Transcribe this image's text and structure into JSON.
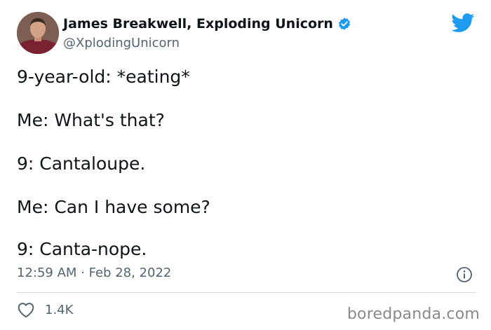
{
  "author": {
    "display_name": "James Breakwell, Exploding Unicorn",
    "handle": "@XplodingUnicorn",
    "avatar_icon": "avatar-photo",
    "verified_icon": "verified-badge-icon"
  },
  "brand": {
    "icon": "twitter-bird-icon",
    "accent_color": "#1d9bf0"
  },
  "tweet": {
    "lines": [
      "9-year-old: *eating*",
      "Me: What's that?",
      "9: Cantaloupe.",
      "Me: Can I have some?",
      "9: Canta-nope."
    ],
    "timestamp": "12:59 AM · Feb 28, 2022",
    "info_icon": "info-icon"
  },
  "engagement": {
    "like_icon": "heart-icon",
    "like_count": "1.4K"
  },
  "watermark": "boredpanda.com"
}
